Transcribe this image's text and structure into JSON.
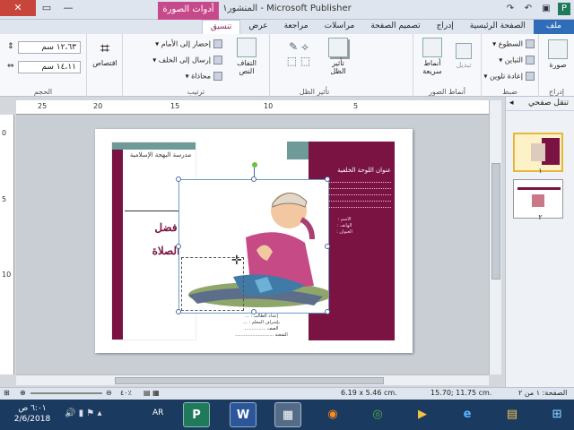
{
  "window": {
    "title": "المنشور١ - Microsoft Publisher",
    "contextual_tab": "أدوات الصورة",
    "controls": {
      "close": "✕",
      "maximize": "▭",
      "minimize": "—"
    },
    "qat_icons": [
      "publisher-icon",
      "save-icon",
      "undo-icon",
      "redo-icon"
    ]
  },
  "tabs": [
    {
      "label": "ملف",
      "kind": "file"
    },
    {
      "label": "الصفحة الرئيسية"
    },
    {
      "label": "إدراج"
    },
    {
      "label": "تصميم الصفحة"
    },
    {
      "label": "مراسلات"
    },
    {
      "label": "مراجعة"
    },
    {
      "label": "عرض"
    },
    {
      "label": "تنسيق",
      "active": true
    }
  ],
  "ribbon": {
    "insert": {
      "label": "إدراج",
      "picture_btn": "صورة"
    },
    "adjust": {
      "label": "ضبط",
      "brightness": "السطوع",
      "contrast": "التباين",
      "recolor": "إعادة تلوين"
    },
    "picture_styles": {
      "label": "أنماط الصور",
      "change": "تبديل",
      "quick_styles_1": "أنماط",
      "quick_styles_2": "سريعة"
    },
    "shadow": {
      "label": "تأثير الظل",
      "shadow_btn_1": "تأثير",
      "shadow_btn_2": "الظل"
    },
    "arrange": {
      "label": "ترتيب",
      "wrap_1": "التفاف",
      "wrap_2": "النص",
      "bring_forward": "إحضار إلى الأمام",
      "send_backward": "إرسال إلى الخلف",
      "align": "محاذاة"
    },
    "crop": {
      "label": "",
      "crop_btn": "اقتصاص"
    },
    "size": {
      "label": "الحجم",
      "height": "١٢،٦٣ سم",
      "width": "١٤،١١ سم"
    }
  },
  "rulers": {
    "h_ticks": [
      "25",
      "20",
      "15",
      "10",
      "5"
    ],
    "v_ticks": [
      "0",
      "5",
      "10"
    ]
  },
  "brochure": {
    "school": "مدرسة البهجة الإسلامية",
    "subject_1": "فضل",
    "subject_2": "الصلاة",
    "back_title": "عنوان اللوحة الخلفية",
    "contact_1": "الاسم :",
    "contact_2": "الهاتف :",
    "contact_3": "العنوان :",
    "mid_text_1": "إعداد الطالب : ...",
    "mid_text_2": "بإشراف المعلم : ...",
    "mid_text_3": "الصف ...............",
    "mid_text_4": "الشعبة ..........................."
  },
  "pages_pane": {
    "title": "تنقل صفحي",
    "collapse_icon": "chevron-left-icon",
    "pages": [
      "١",
      "٢"
    ]
  },
  "status": {
    "page": "الصفحة: ١ من ٢",
    "position": "15.70; 11.75 cm.",
    "size": "6.19 x  5.46 cm.",
    "zoom": "٤٠٪"
  },
  "taskbar": {
    "time": "٦:٠١ ص",
    "date": "2/6/2018",
    "lang": "AR",
    "apps": [
      "P",
      "W",
      "▦",
      "◉",
      "◎",
      "▶",
      "e",
      "▤",
      "⊞"
    ]
  },
  "colors": {
    "maroon": "#7a1242",
    "teal": "#6e9a98",
    "file_tab": "#2f6db8",
    "context_tab": "#c64a8b"
  }
}
